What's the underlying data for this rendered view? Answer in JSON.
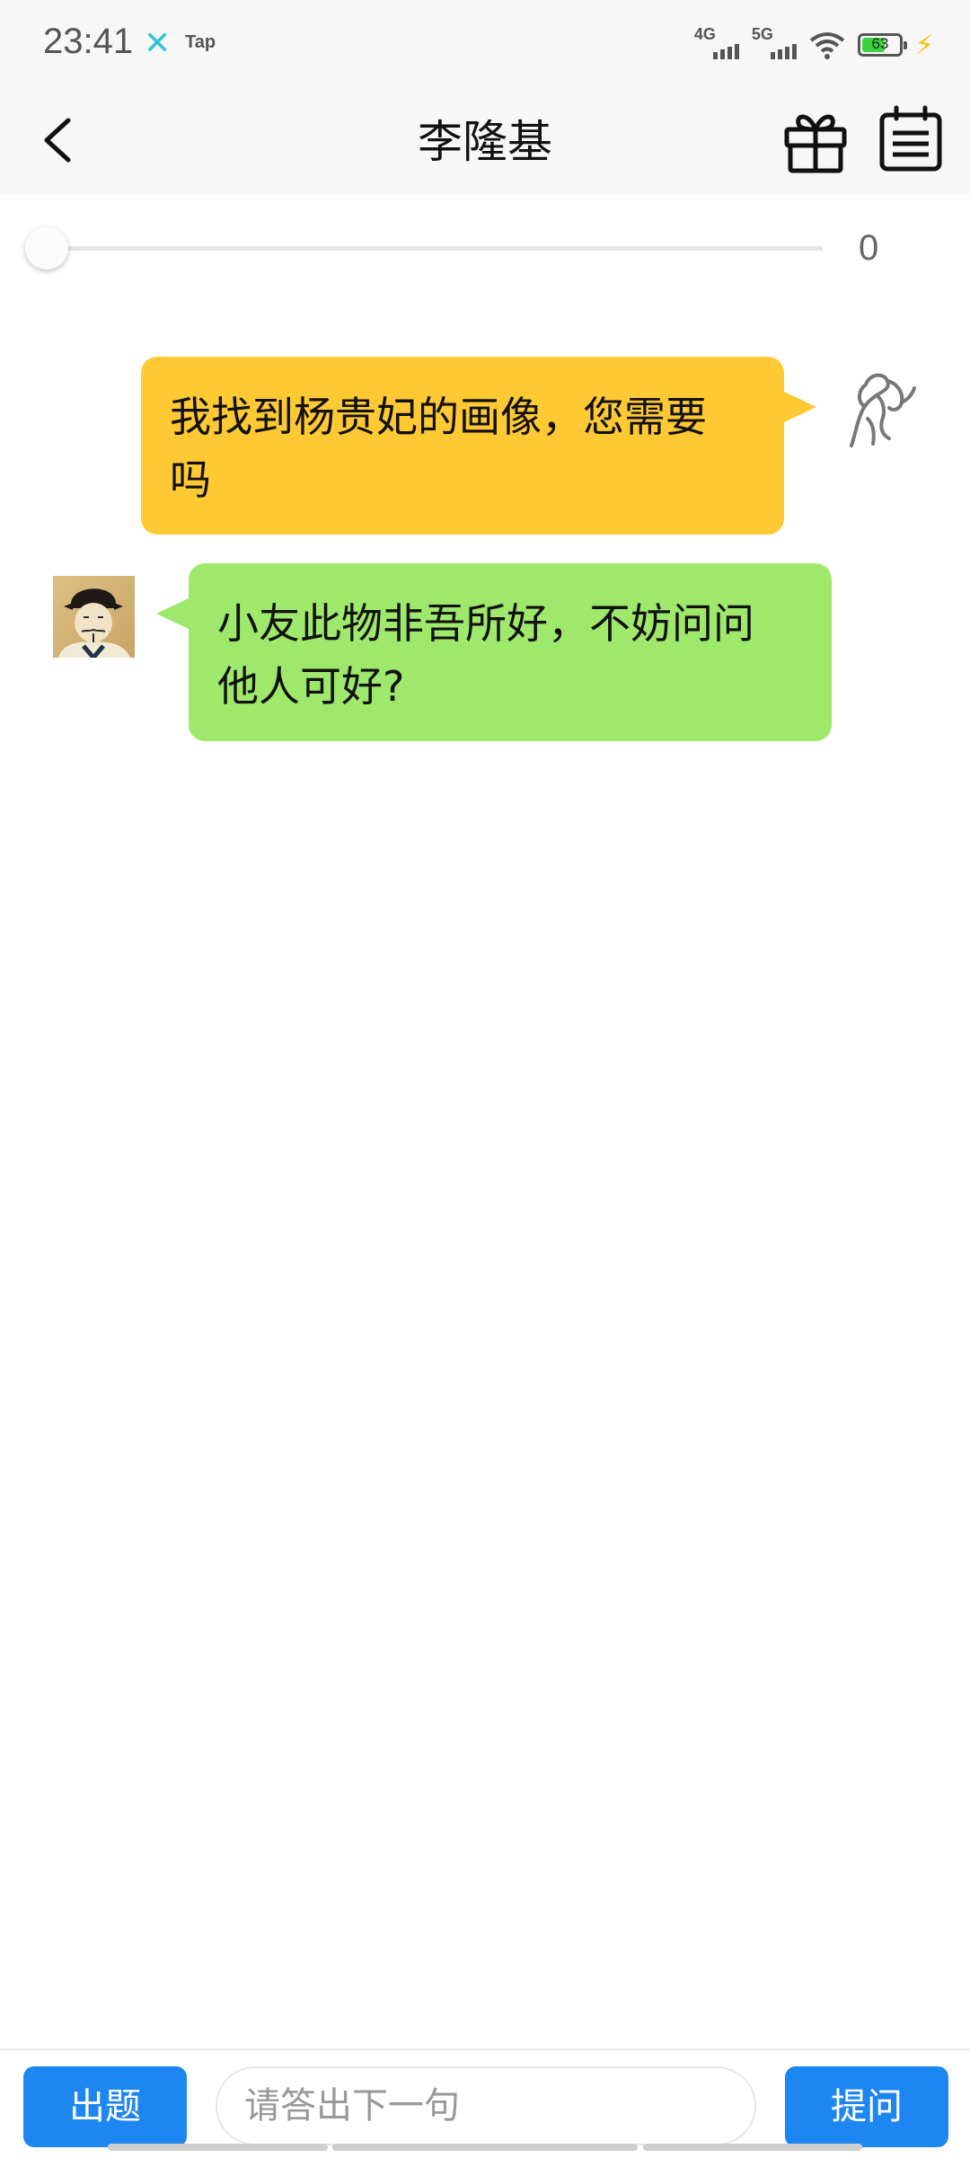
{
  "status_bar": {
    "time": "23:41",
    "app_icon": "x-icon",
    "app_label": "Tap",
    "network_1": "4G",
    "network_2": "5G",
    "battery_level": 63,
    "battery_text": "63",
    "charging_icon": "bolt-icon"
  },
  "nav": {
    "title": "李隆基",
    "back_icon": "chevron-left-icon",
    "gift_icon": "gift-icon",
    "menu_icon": "list-icon"
  },
  "progress": {
    "value": 0,
    "label": "0"
  },
  "messages": [
    {
      "sender": "user",
      "line1": "我找到杨贵妃的画像，您需要",
      "line2": "吗",
      "bubble_color": "#ffc933"
    },
    {
      "sender": "李隆基",
      "line1": "小友此物非吾所好，不妨问问",
      "line2": "他人可好?",
      "bubble_color": "#9ee86b"
    }
  ],
  "bottom_bar": {
    "left_button": "出题",
    "input_placeholder": "请答出下一句",
    "right_button": "提问",
    "accent": "#1e86f0"
  }
}
